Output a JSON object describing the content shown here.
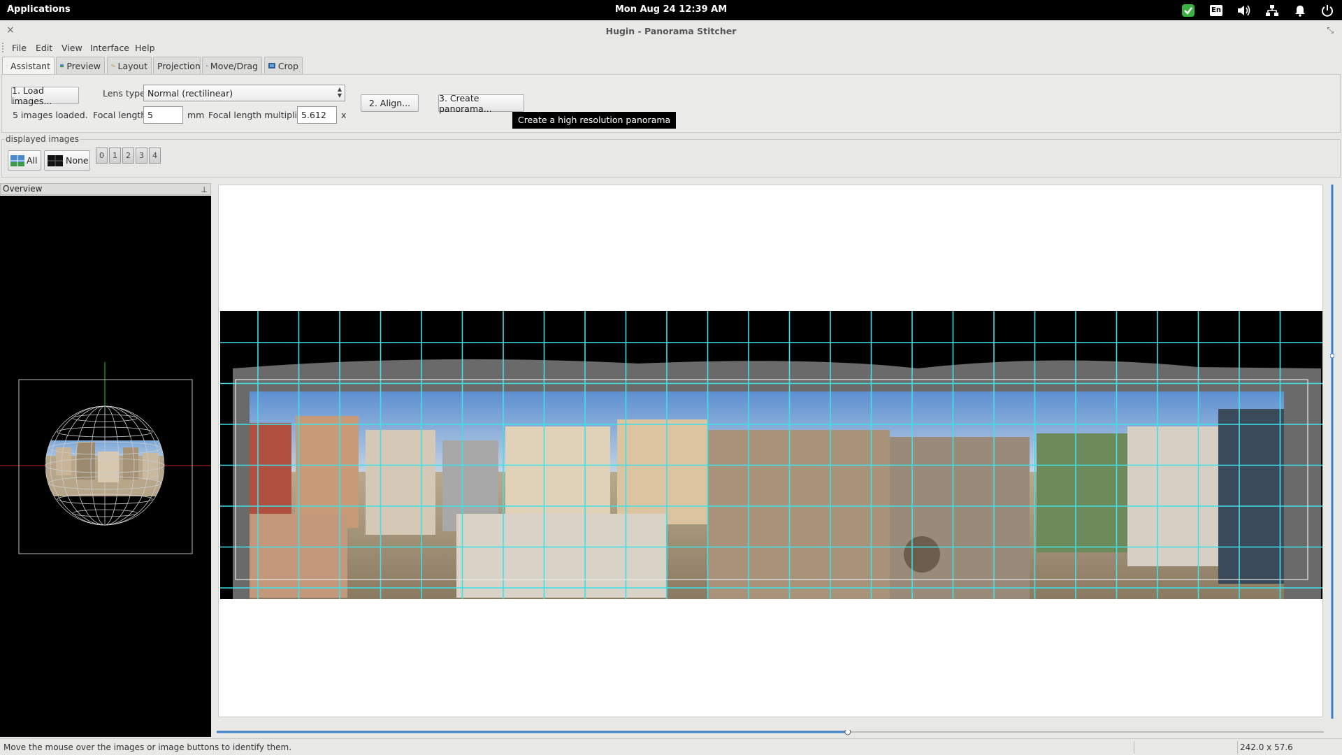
{
  "topbar": {
    "applications": "Applications",
    "datetime": "Mon Aug 24   12:39 AM",
    "tray_icons": [
      "check-shield-icon",
      "keyboard-layout-icon",
      "volume-icon",
      "network-icon",
      "bell-icon",
      "power-icon"
    ],
    "keyboard_layout": "En"
  },
  "window": {
    "title": "Hugin - Panorama Stitcher",
    "close_glyph": "×",
    "restore_glyph": "⤡"
  },
  "menu": [
    "File",
    "Edit",
    "View",
    "Interface",
    "Help"
  ],
  "tabs": [
    "Assistant",
    "Preview",
    "Layout",
    "Projection",
    "Move/Drag",
    "Crop"
  ],
  "active_tab": "Assistant",
  "assistant": {
    "load_button": "1. Load images...",
    "images_loaded": "5 images loaded.",
    "lens_type_label": "Lens type:",
    "lens_type_value": "Normal (rectilinear)",
    "focal_length_label": "Focal length:",
    "focal_length_value": "5",
    "focal_length_unit": "mm",
    "multiplier_label": "Focal length multiplier:",
    "multiplier_value": "5.612",
    "multiplier_unit": "x",
    "align_button": "2. Align...",
    "create_button": "3. Create panorama...",
    "tooltip": "Create a high resolution panorama"
  },
  "displayed_images": {
    "legend": "displayed images",
    "all_button": "All",
    "none_button": "None",
    "image_buttons": [
      "0",
      "1",
      "2",
      "3",
      "4"
    ]
  },
  "overview": {
    "title": "Overview",
    "pin_glyph": "⊥"
  },
  "statusbar": {
    "message": "Move the mouse over the images or image buttons to identify them.",
    "dimensions": "242.0 x 57.6"
  },
  "colors": {
    "grid": "#3fe0e6",
    "scroll_accent": "#3d7fc6"
  },
  "horizontal_scroll_position": 0.57
}
